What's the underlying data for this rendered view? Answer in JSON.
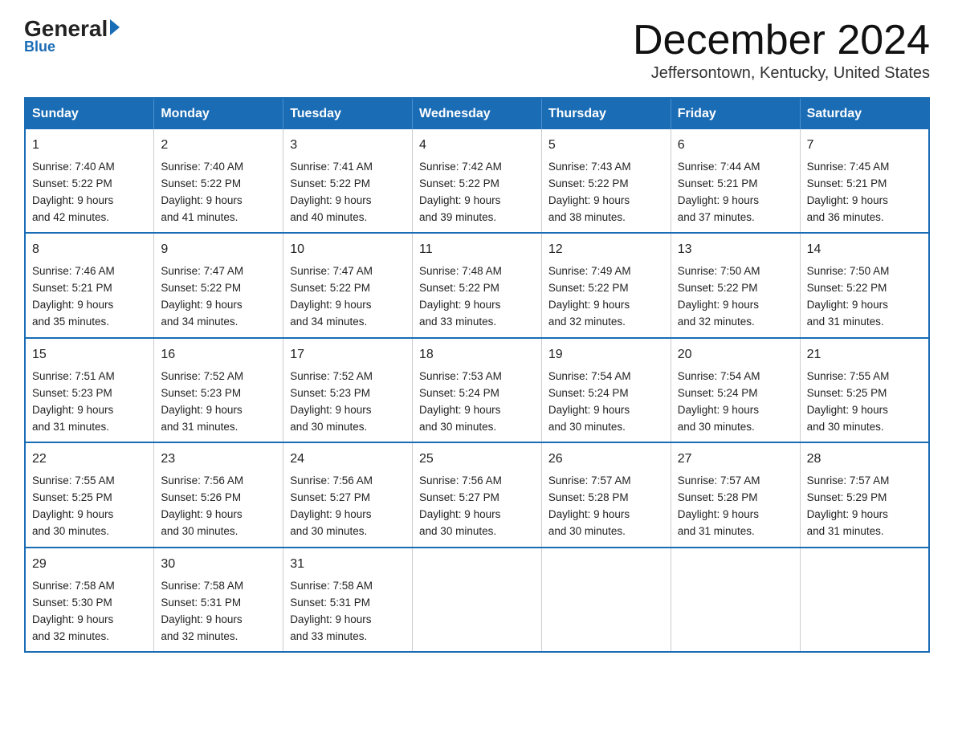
{
  "header": {
    "logo_general": "General",
    "logo_blue": "Blue",
    "title": "December 2024",
    "subtitle": "Jeffersontown, Kentucky, United States"
  },
  "days_of_week": [
    "Sunday",
    "Monday",
    "Tuesday",
    "Wednesday",
    "Thursday",
    "Friday",
    "Saturday"
  ],
  "weeks": [
    [
      {
        "day": "1",
        "sunrise": "7:40 AM",
        "sunset": "5:22 PM",
        "daylight": "9 hours and 42 minutes."
      },
      {
        "day": "2",
        "sunrise": "7:40 AM",
        "sunset": "5:22 PM",
        "daylight": "9 hours and 41 minutes."
      },
      {
        "day": "3",
        "sunrise": "7:41 AM",
        "sunset": "5:22 PM",
        "daylight": "9 hours and 40 minutes."
      },
      {
        "day": "4",
        "sunrise": "7:42 AM",
        "sunset": "5:22 PM",
        "daylight": "9 hours and 39 minutes."
      },
      {
        "day": "5",
        "sunrise": "7:43 AM",
        "sunset": "5:22 PM",
        "daylight": "9 hours and 38 minutes."
      },
      {
        "day": "6",
        "sunrise": "7:44 AM",
        "sunset": "5:21 PM",
        "daylight": "9 hours and 37 minutes."
      },
      {
        "day": "7",
        "sunrise": "7:45 AM",
        "sunset": "5:21 PM",
        "daylight": "9 hours and 36 minutes."
      }
    ],
    [
      {
        "day": "8",
        "sunrise": "7:46 AM",
        "sunset": "5:21 PM",
        "daylight": "9 hours and 35 minutes."
      },
      {
        "day": "9",
        "sunrise": "7:47 AM",
        "sunset": "5:22 PM",
        "daylight": "9 hours and 34 minutes."
      },
      {
        "day": "10",
        "sunrise": "7:47 AM",
        "sunset": "5:22 PM",
        "daylight": "9 hours and 34 minutes."
      },
      {
        "day": "11",
        "sunrise": "7:48 AM",
        "sunset": "5:22 PM",
        "daylight": "9 hours and 33 minutes."
      },
      {
        "day": "12",
        "sunrise": "7:49 AM",
        "sunset": "5:22 PM",
        "daylight": "9 hours and 32 minutes."
      },
      {
        "day": "13",
        "sunrise": "7:50 AM",
        "sunset": "5:22 PM",
        "daylight": "9 hours and 32 minutes."
      },
      {
        "day": "14",
        "sunrise": "7:50 AM",
        "sunset": "5:22 PM",
        "daylight": "9 hours and 31 minutes."
      }
    ],
    [
      {
        "day": "15",
        "sunrise": "7:51 AM",
        "sunset": "5:23 PM",
        "daylight": "9 hours and 31 minutes."
      },
      {
        "day": "16",
        "sunrise": "7:52 AM",
        "sunset": "5:23 PM",
        "daylight": "9 hours and 31 minutes."
      },
      {
        "day": "17",
        "sunrise": "7:52 AM",
        "sunset": "5:23 PM",
        "daylight": "9 hours and 30 minutes."
      },
      {
        "day": "18",
        "sunrise": "7:53 AM",
        "sunset": "5:24 PM",
        "daylight": "9 hours and 30 minutes."
      },
      {
        "day": "19",
        "sunrise": "7:54 AM",
        "sunset": "5:24 PM",
        "daylight": "9 hours and 30 minutes."
      },
      {
        "day": "20",
        "sunrise": "7:54 AM",
        "sunset": "5:24 PM",
        "daylight": "9 hours and 30 minutes."
      },
      {
        "day": "21",
        "sunrise": "7:55 AM",
        "sunset": "5:25 PM",
        "daylight": "9 hours and 30 minutes."
      }
    ],
    [
      {
        "day": "22",
        "sunrise": "7:55 AM",
        "sunset": "5:25 PM",
        "daylight": "9 hours and 30 minutes."
      },
      {
        "day": "23",
        "sunrise": "7:56 AM",
        "sunset": "5:26 PM",
        "daylight": "9 hours and 30 minutes."
      },
      {
        "day": "24",
        "sunrise": "7:56 AM",
        "sunset": "5:27 PM",
        "daylight": "9 hours and 30 minutes."
      },
      {
        "day": "25",
        "sunrise": "7:56 AM",
        "sunset": "5:27 PM",
        "daylight": "9 hours and 30 minutes."
      },
      {
        "day": "26",
        "sunrise": "7:57 AM",
        "sunset": "5:28 PM",
        "daylight": "9 hours and 30 minutes."
      },
      {
        "day": "27",
        "sunrise": "7:57 AM",
        "sunset": "5:28 PM",
        "daylight": "9 hours and 31 minutes."
      },
      {
        "day": "28",
        "sunrise": "7:57 AM",
        "sunset": "5:29 PM",
        "daylight": "9 hours and 31 minutes."
      }
    ],
    [
      {
        "day": "29",
        "sunrise": "7:58 AM",
        "sunset": "5:30 PM",
        "daylight": "9 hours and 32 minutes."
      },
      {
        "day": "30",
        "sunrise": "7:58 AM",
        "sunset": "5:31 PM",
        "daylight": "9 hours and 32 minutes."
      },
      {
        "day": "31",
        "sunrise": "7:58 AM",
        "sunset": "5:31 PM",
        "daylight": "9 hours and 33 minutes."
      },
      null,
      null,
      null,
      null
    ]
  ],
  "labels": {
    "sunrise": "Sunrise:",
    "sunset": "Sunset:",
    "daylight": "Daylight:"
  }
}
